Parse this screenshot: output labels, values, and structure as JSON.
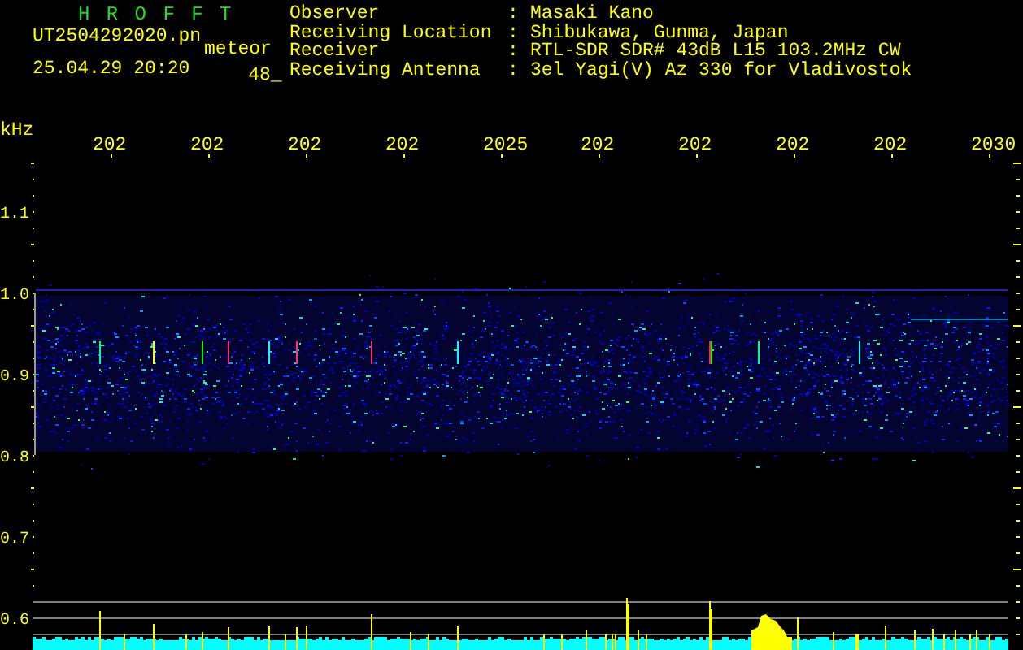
{
  "header": {
    "title": "H R O F F T",
    "file_name": "UT2504292020.pn",
    "file_suffix": "meteor",
    "timestamp": "25.04.29 20:20",
    "count": "48_"
  },
  "info": [
    {
      "label": "Observer",
      "separator": ":",
      "value": "Masaki Kano"
    },
    {
      "label": "Receiving Location",
      "separator": ":",
      "value": "Shibukawa, Gunma, Japan"
    },
    {
      "label": "Receiver",
      "separator": ":",
      "value": "RTL-SDR SDR# 43dB L15 103.2MHz CW"
    },
    {
      "label": "Receiving Antenna",
      "separator": ":",
      "value": "3el Yagi(V) Az 330 for Vladivostok"
    }
  ],
  "plot": {
    "unit": "kHz",
    "x_labels": [
      "202",
      "202",
      "202",
      "202",
      "2025",
      "202",
      "202",
      "202",
      "202",
      "2030"
    ],
    "y_labels": [
      "1.1",
      "1.0",
      "0.9",
      "0.8",
      "0.7",
      "0.6"
    ]
  }
}
